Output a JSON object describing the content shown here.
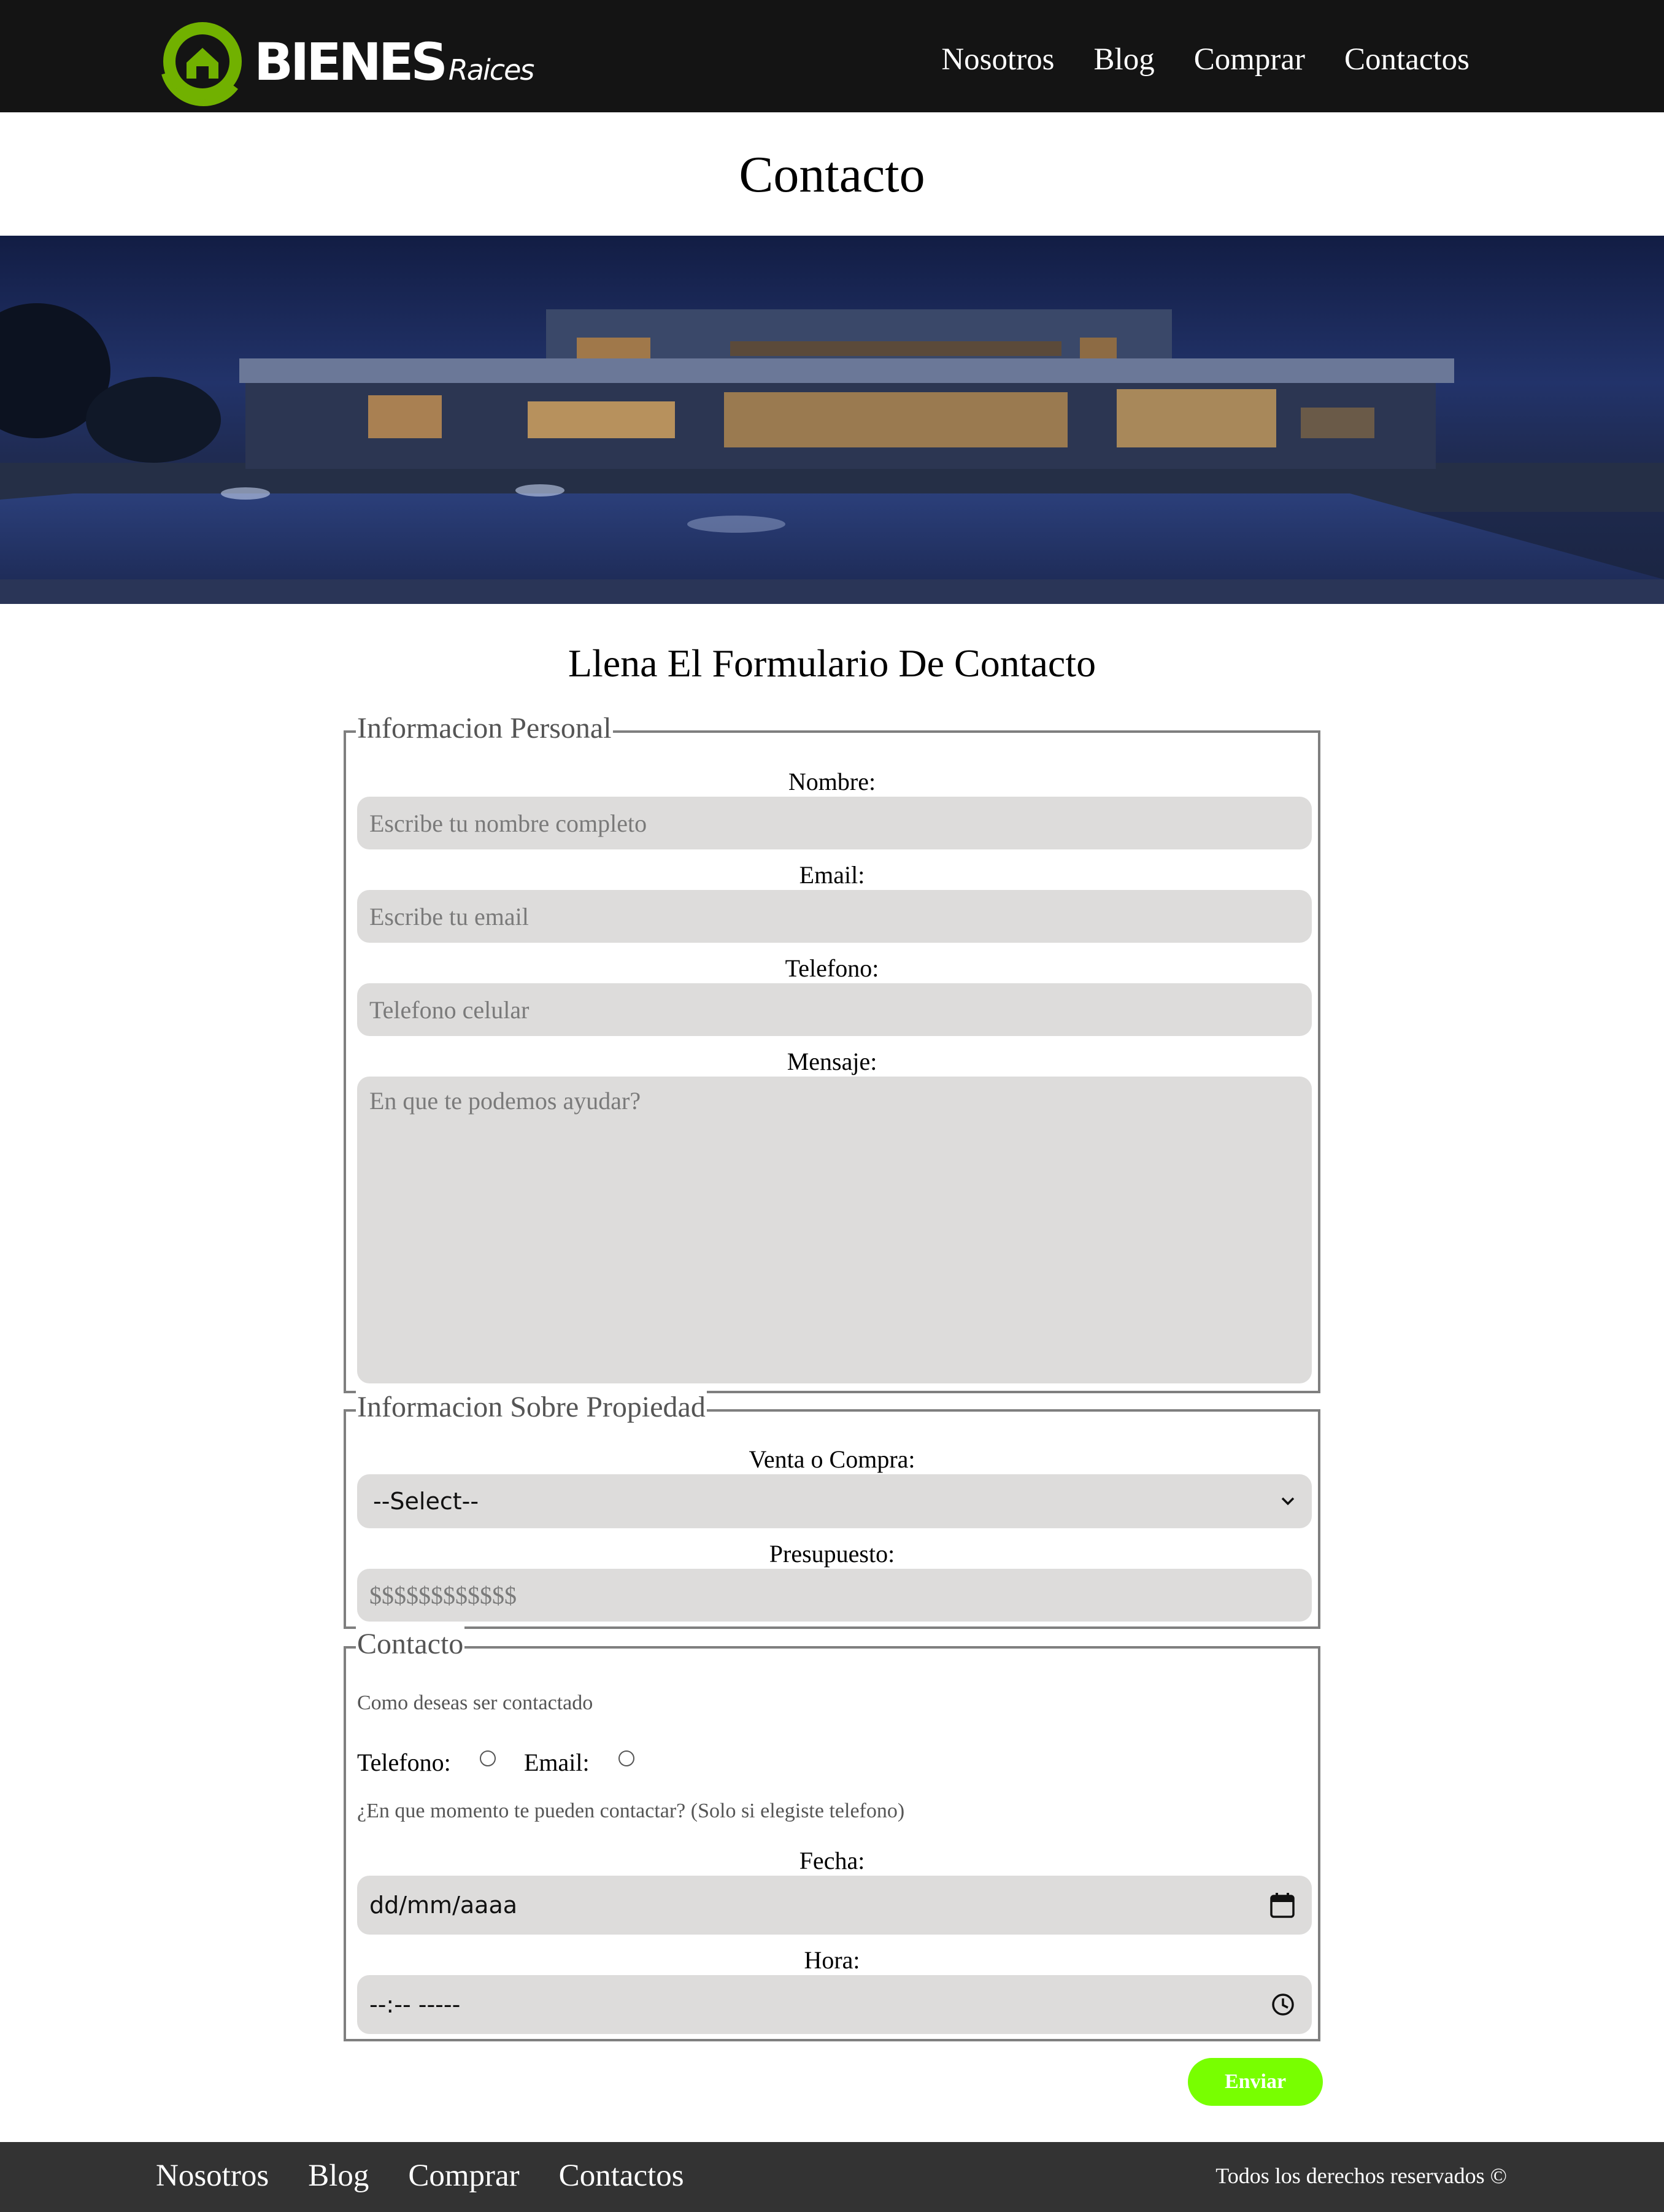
{
  "header": {
    "logo": {
      "word": "BIENES",
      "sub": "Raices"
    },
    "nav": [
      "Nosotros",
      "Blog",
      "Comprar",
      "Contactos"
    ]
  },
  "page_title": "Contacto",
  "form": {
    "title": "Llena El Formulario De Contacto",
    "personal": {
      "legend": "Informacion Personal",
      "nombre_label": "Nombre:",
      "nombre_placeholder": "Escribe tu nombre completo",
      "email_label": "Email:",
      "email_placeholder": "Escribe tu email",
      "telefono_label": "Telefono:",
      "telefono_placeholder": "Telefono celular",
      "mensaje_label": "Mensaje:",
      "mensaje_placeholder": "En que te podemos ayudar?"
    },
    "propiedad": {
      "legend": "Informacion Sobre Propiedad",
      "venta_label": "Venta o Compra:",
      "venta_selected": "--Select--",
      "presupuesto_label": "Presupuesto:",
      "presupuesto_placeholder": "$$$$$$$$$$$$"
    },
    "contacto": {
      "legend": "Contacto",
      "note1": "Como deseas ser contactado",
      "radio_telefono": "Telefono:",
      "radio_email": "Email:",
      "note2": "¿En que momento te pueden contactar? (Solo si elegiste telefono)",
      "fecha_label": "Fecha:",
      "fecha_value": "dd/mm/aaaa",
      "hora_label": "Hora:",
      "hora_value": "--:-- -----"
    },
    "submit": "Enviar"
  },
  "footer": {
    "nav": [
      "Nosotros",
      "Blog",
      "Comprar",
      "Contactos"
    ],
    "copyright": "Todos los derechos reservados ©"
  },
  "colors": {
    "header_bg": "#141414",
    "footer_bg": "#333333",
    "accent_green": "#78ff00",
    "logo_green": "#71b100",
    "field_bg": "#dddcdb"
  }
}
